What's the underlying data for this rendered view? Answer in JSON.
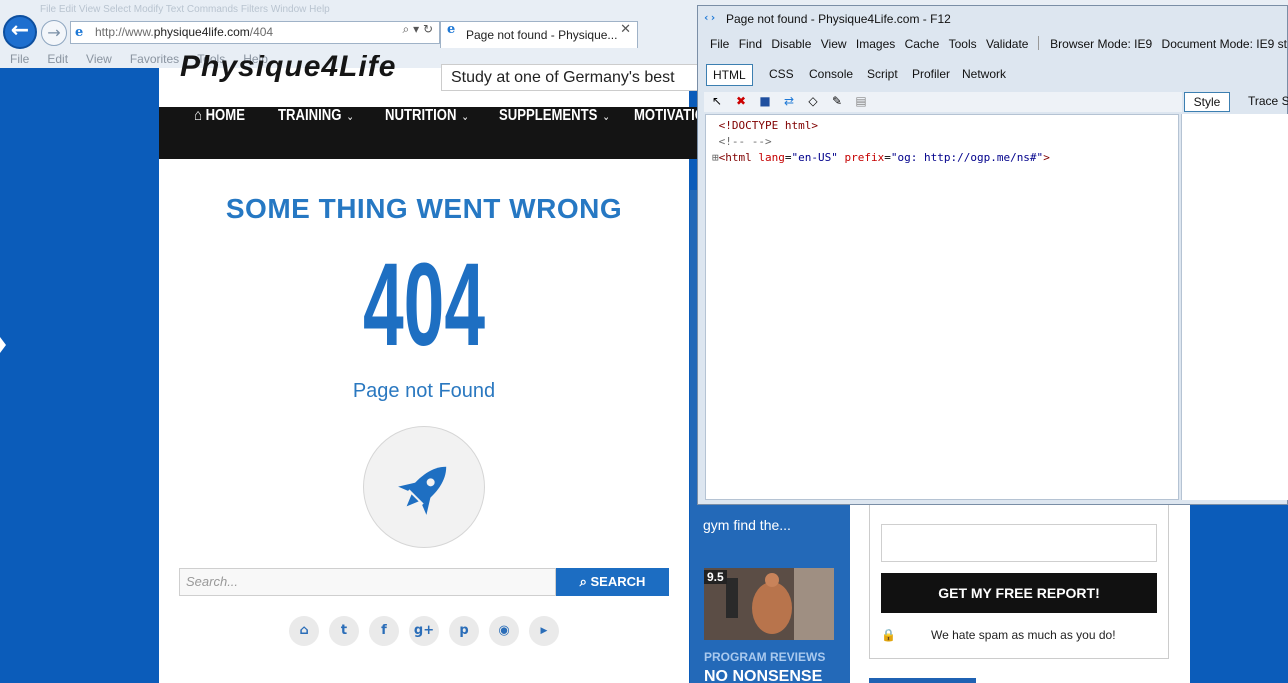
{
  "browser": {
    "ghost_menu": "File  Edit  View  Select  Modify  Text  Commands  Filters  Window  Help",
    "address_prefix": "http://www.",
    "address_domain": "physique4life.com",
    "address_path": "/404",
    "tab_title": "Page not found - Physique...",
    "menu": [
      "File",
      "Edit",
      "View",
      "Favorites",
      "Tools",
      "Help"
    ]
  },
  "site": {
    "logo": "Physique4Life",
    "promo": "Study at one of Germany's best",
    "nav": [
      "HOME",
      "TRAINING",
      "NUTRITION",
      "SUPPLEMENTS",
      "MOTIVATIO"
    ],
    "error_title": "SOME THING WENT WRONG",
    "error_code": "404",
    "error_message": "Page not Found",
    "search_placeholder": "Search...",
    "search_label": "SEARCH",
    "social_icons": [
      "home-icon",
      "twitter-icon",
      "facebook-icon",
      "google-plus-icon",
      "pinterest-icon",
      "rss-icon",
      "youtube-icon"
    ]
  },
  "sidebar": {
    "gym_text": "gym find the...",
    "score": "9.5",
    "category": "PROGRAM REVIEWS",
    "headline": "NO NONSENSE",
    "cta": "GET MY FREE REPORT!",
    "spam": "We hate spam as much as you do!"
  },
  "devtools": {
    "title": "Page not found - Physique4Life.com - F12",
    "menu": [
      "File",
      "Find",
      "Disable",
      "View",
      "Images",
      "Cache",
      "Tools",
      "Validate"
    ],
    "browser_mode": "Browser Mode: IE9",
    "document_mode": "Document Mode: IE9 st",
    "tabs": [
      "HTML",
      "CSS",
      "Console",
      "Script",
      "Profiler",
      "Network"
    ],
    "tree": {
      "doctype": "<!DOCTYPE html>",
      "comment": "<!--  -->",
      "html_open": "<html",
      "attr1": "lang",
      "val1": "\"en-US\"",
      "attr2": "prefix",
      "val2": "\"og: http://ogp.me/ns#\"",
      "close": ">"
    },
    "right_tabs": [
      "Style",
      "Trace St"
    ]
  },
  "colors": {
    "accent": "#1e6fc2",
    "nav_bg": "#141414",
    "side_bg": "#0b5cba"
  }
}
